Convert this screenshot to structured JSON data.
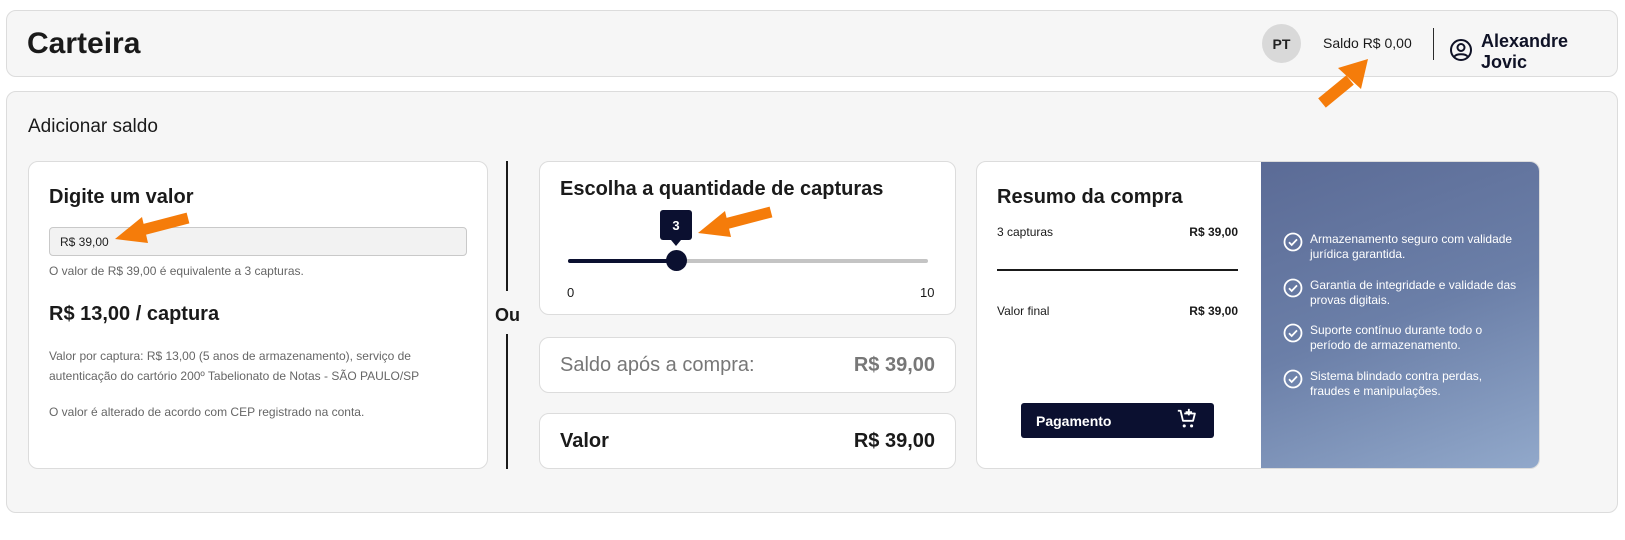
{
  "header": {
    "title": "Carteira",
    "language": "PT",
    "balance": "Saldo R$ 0,00",
    "user_name": "Alexandre Jovic"
  },
  "main": {
    "section_title": "Adicionar saldo",
    "value_card": {
      "title": "Digite um valor",
      "input_value": "R$ 39,00",
      "hint": "O valor de R$ 39,00 é equivalente a 3 capturas.",
      "price_per_capture": "R$ 13,00 / captura",
      "description": "Valor por captura: R$ 13,00 (5 anos de armazenamento), serviço de autenticação do cartório 200º Tabelionato de Notas - SÃO PAULO/SP",
      "cep_note": "O valor é alterado de acordo com CEP registrado na conta."
    },
    "or_label": "Ou",
    "quantity_card": {
      "title": "Escolha a quantidade de capturas",
      "min_label": "0",
      "max_label": "10",
      "min": 0,
      "max": 10,
      "value": 3,
      "value_label": "3"
    },
    "balance_after": {
      "label": "Saldo após a compra:",
      "value": "R$ 39,00"
    },
    "total": {
      "label": "Valor",
      "value": "R$ 39,00"
    },
    "summary": {
      "title": "Resumo da compra",
      "items_label": "3 capturas",
      "items_value": "R$ 39,00",
      "final_label": "Valor final",
      "final_value": "R$ 39,00",
      "pay_label": "Pagamento"
    },
    "benefits": [
      "Armazenamento seguro com validade jurídica garantida.",
      "Garantia de integridade e validade das provas digitais.",
      "Suporte contínuo durante todo o período de armazenamento.",
      "Sistema blindado contra perdas, fraudes e manipulações."
    ]
  },
  "colors": {
    "navy": "#0b1030",
    "annotation_arrow": "#f57c0a",
    "benefits_gradient_start": "#5b6b96",
    "benefits_gradient_end": "#92a9cb"
  },
  "icons": {
    "user": "user-circle-icon",
    "cart": "cart-add-icon",
    "check": "check-circle-icon"
  }
}
